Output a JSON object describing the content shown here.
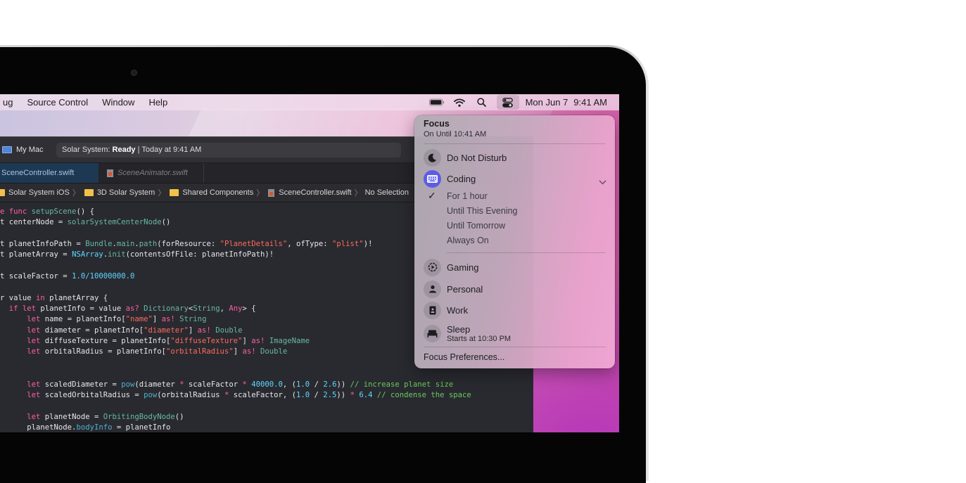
{
  "menubar": {
    "left_items": [
      "ug",
      "Source Control",
      "Window",
      "Help"
    ],
    "status_icons": [
      "battery-icon",
      "wifi-icon",
      "search-icon",
      "control-center-icon"
    ],
    "date": "Mon Jun 7",
    "time": "9:41 AM"
  },
  "xcode": {
    "scheme": "My Mac",
    "status": {
      "project": "Solar System: ",
      "state": "Ready",
      "separator": " | ",
      "time": "Today at 9:41 AM"
    },
    "tabs": [
      {
        "label": "SceneController.swift",
        "active": true
      },
      {
        "label": "SceneAnimator.swift",
        "active": false
      }
    ],
    "breadcrumb": [
      "Solar System iOS",
      "3D Solar System",
      "Shared Components",
      "SceneController.swift",
      "No Selection"
    ],
    "code_lines": [
      [
        [
          "kw",
          "e "
        ],
        [
          "kw",
          "func "
        ],
        [
          "fn",
          "setupScene"
        ],
        [
          "",
          "() {"
        ]
      ],
      [
        [
          "",
          "t centerNode = "
        ],
        [
          "fn",
          "solarSystemCenterNode"
        ],
        [
          "",
          "()"
        ]
      ],
      [],
      [
        [
          "",
          "t planetInfoPath = "
        ],
        [
          "fn",
          "Bundle"
        ],
        [
          "",
          "."
        ],
        [
          "fn",
          "main"
        ],
        [
          "",
          "."
        ],
        [
          "fn",
          "path"
        ],
        [
          "",
          "(forResource: "
        ],
        [
          "str",
          "\"PlanetDetails\""
        ],
        [
          "",
          ", ofType: "
        ],
        [
          "str",
          "\"plist\""
        ],
        [
          "",
          ")!"
        ]
      ],
      [
        [
          "",
          "t planetArray = "
        ],
        [
          "ty",
          "NSArray"
        ],
        [
          "",
          "."
        ],
        [
          "fn",
          "init"
        ],
        [
          "",
          "(contentsOfFile: planetInfoPath)!"
        ]
      ],
      [],
      [
        [
          "",
          "t scaleFactor = "
        ],
        [
          "num",
          "1.0/10000000.0"
        ]
      ],
      [],
      [
        [
          "",
          "r value "
        ],
        [
          "kw",
          "in"
        ],
        [
          "",
          " planetArray {"
        ]
      ],
      [
        [
          "",
          "  "
        ],
        [
          "kw",
          "if let"
        ],
        [
          "",
          " planetInfo = value "
        ],
        [
          "kw",
          "as?"
        ],
        [
          " ",
          ""
        ],
        [
          "tyb",
          "Dictionary"
        ],
        [
          "",
          "<"
        ],
        [
          "tyb",
          "String"
        ],
        [
          "",
          ", "
        ],
        [
          "kw",
          "Any"
        ],
        [
          "",
          "> {"
        ]
      ],
      [
        [
          "",
          "      "
        ],
        [
          "kw",
          "let"
        ],
        [
          "",
          " name = planetInfo["
        ],
        [
          "str",
          "\"name\""
        ],
        [
          "",
          "] "
        ],
        [
          "kw",
          "as!"
        ],
        [
          "tyb",
          " String"
        ]
      ],
      [
        [
          "",
          "      "
        ],
        [
          "kw",
          "let"
        ],
        [
          "",
          " diameter = planetInfo["
        ],
        [
          "str",
          "\"diameter\""
        ],
        [
          "",
          "] "
        ],
        [
          "kw",
          "as!"
        ],
        [
          "tyb",
          " Double"
        ]
      ],
      [
        [
          "",
          "      "
        ],
        [
          "kw",
          "let"
        ],
        [
          "",
          " diffuseTexture = planetInfo["
        ],
        [
          "str",
          "\"diffuseTexture\""
        ],
        [
          "",
          "] "
        ],
        [
          "kw",
          "as!"
        ],
        [
          "tyb",
          " ImageName"
        ]
      ],
      [
        [
          "",
          "      "
        ],
        [
          "kw",
          "let"
        ],
        [
          "",
          " orbitalRadius = planetInfo["
        ],
        [
          "str",
          "\"orbitalRadius\""
        ],
        [
          "",
          "] "
        ],
        [
          "kw",
          "as!"
        ],
        [
          "tyb",
          " Double"
        ]
      ],
      [],
      [],
      [
        [
          "",
          "      "
        ],
        [
          "kw",
          "let"
        ],
        [
          "",
          " scaledDiameter = "
        ],
        [
          "pr",
          "pow"
        ],
        [
          "",
          "(diameter "
        ],
        [
          "kw",
          "*"
        ],
        [
          "",
          " scaleFactor "
        ],
        [
          "kw",
          "*"
        ],
        [
          " ",
          ""
        ],
        [
          "num",
          "40000.0"
        ],
        [
          "",
          ", ("
        ],
        [
          "num",
          "1.0"
        ],
        [
          "",
          " / "
        ],
        [
          "num",
          "2.6"
        ],
        [
          "",
          "))"
        ],
        [
          "cm",
          " // increase planet size"
        ]
      ],
      [
        [
          "",
          "      "
        ],
        [
          "kw",
          "let"
        ],
        [
          "",
          " scaledOrbitalRadius = "
        ],
        [
          "pr",
          "pow"
        ],
        [
          "",
          "(orbitalRadius "
        ],
        [
          "kw",
          "*"
        ],
        [
          "",
          " scaleFactor, ("
        ],
        [
          "num",
          "1.0"
        ],
        [
          "",
          " / "
        ],
        [
          "num",
          "2.5"
        ],
        [
          "",
          "))"
        ],
        [
          "kw",
          " *"
        ],
        [
          " ",
          ""
        ],
        [
          "num",
          "6.4"
        ],
        [
          "cm",
          " // condense the space"
        ]
      ],
      [],
      [
        [
          "",
          "      "
        ],
        [
          "kw",
          "let"
        ],
        [
          "",
          " planetNode = "
        ],
        [
          "tyb",
          "OrbitingBodyNode"
        ],
        [
          "",
          "()"
        ]
      ],
      [
        [
          "",
          "      planetNode."
        ],
        [
          "pr",
          "bodyInfo"
        ],
        [
          "",
          " = planetInfo"
        ]
      ]
    ]
  },
  "focus": {
    "title": "Focus",
    "subtitle": "On Until 10:41 AM",
    "modes": [
      {
        "name": "Do Not Disturb",
        "icon": "moon-icon",
        "active": false
      },
      {
        "name": "Coding",
        "icon": "keyboard-icon",
        "active": true
      },
      {
        "name": "Gaming",
        "icon": "gaming-icon",
        "active": false
      },
      {
        "name": "Personal",
        "icon": "person-icon",
        "active": false
      },
      {
        "name": "Work",
        "icon": "badge-icon",
        "active": false
      },
      {
        "name": "Sleep",
        "icon": "bed-icon",
        "active": false,
        "subtitle": "Starts at 10:30 PM"
      }
    ],
    "durations": [
      {
        "label": "For 1 hour",
        "selected": true
      },
      {
        "label": "Until This Evening",
        "selected": false
      },
      {
        "label": "Until Tomorrow",
        "selected": false
      },
      {
        "label": "Always On",
        "selected": false
      }
    ],
    "preferences_label": "Focus Preferences...",
    "accent": "#5d5ce6"
  }
}
